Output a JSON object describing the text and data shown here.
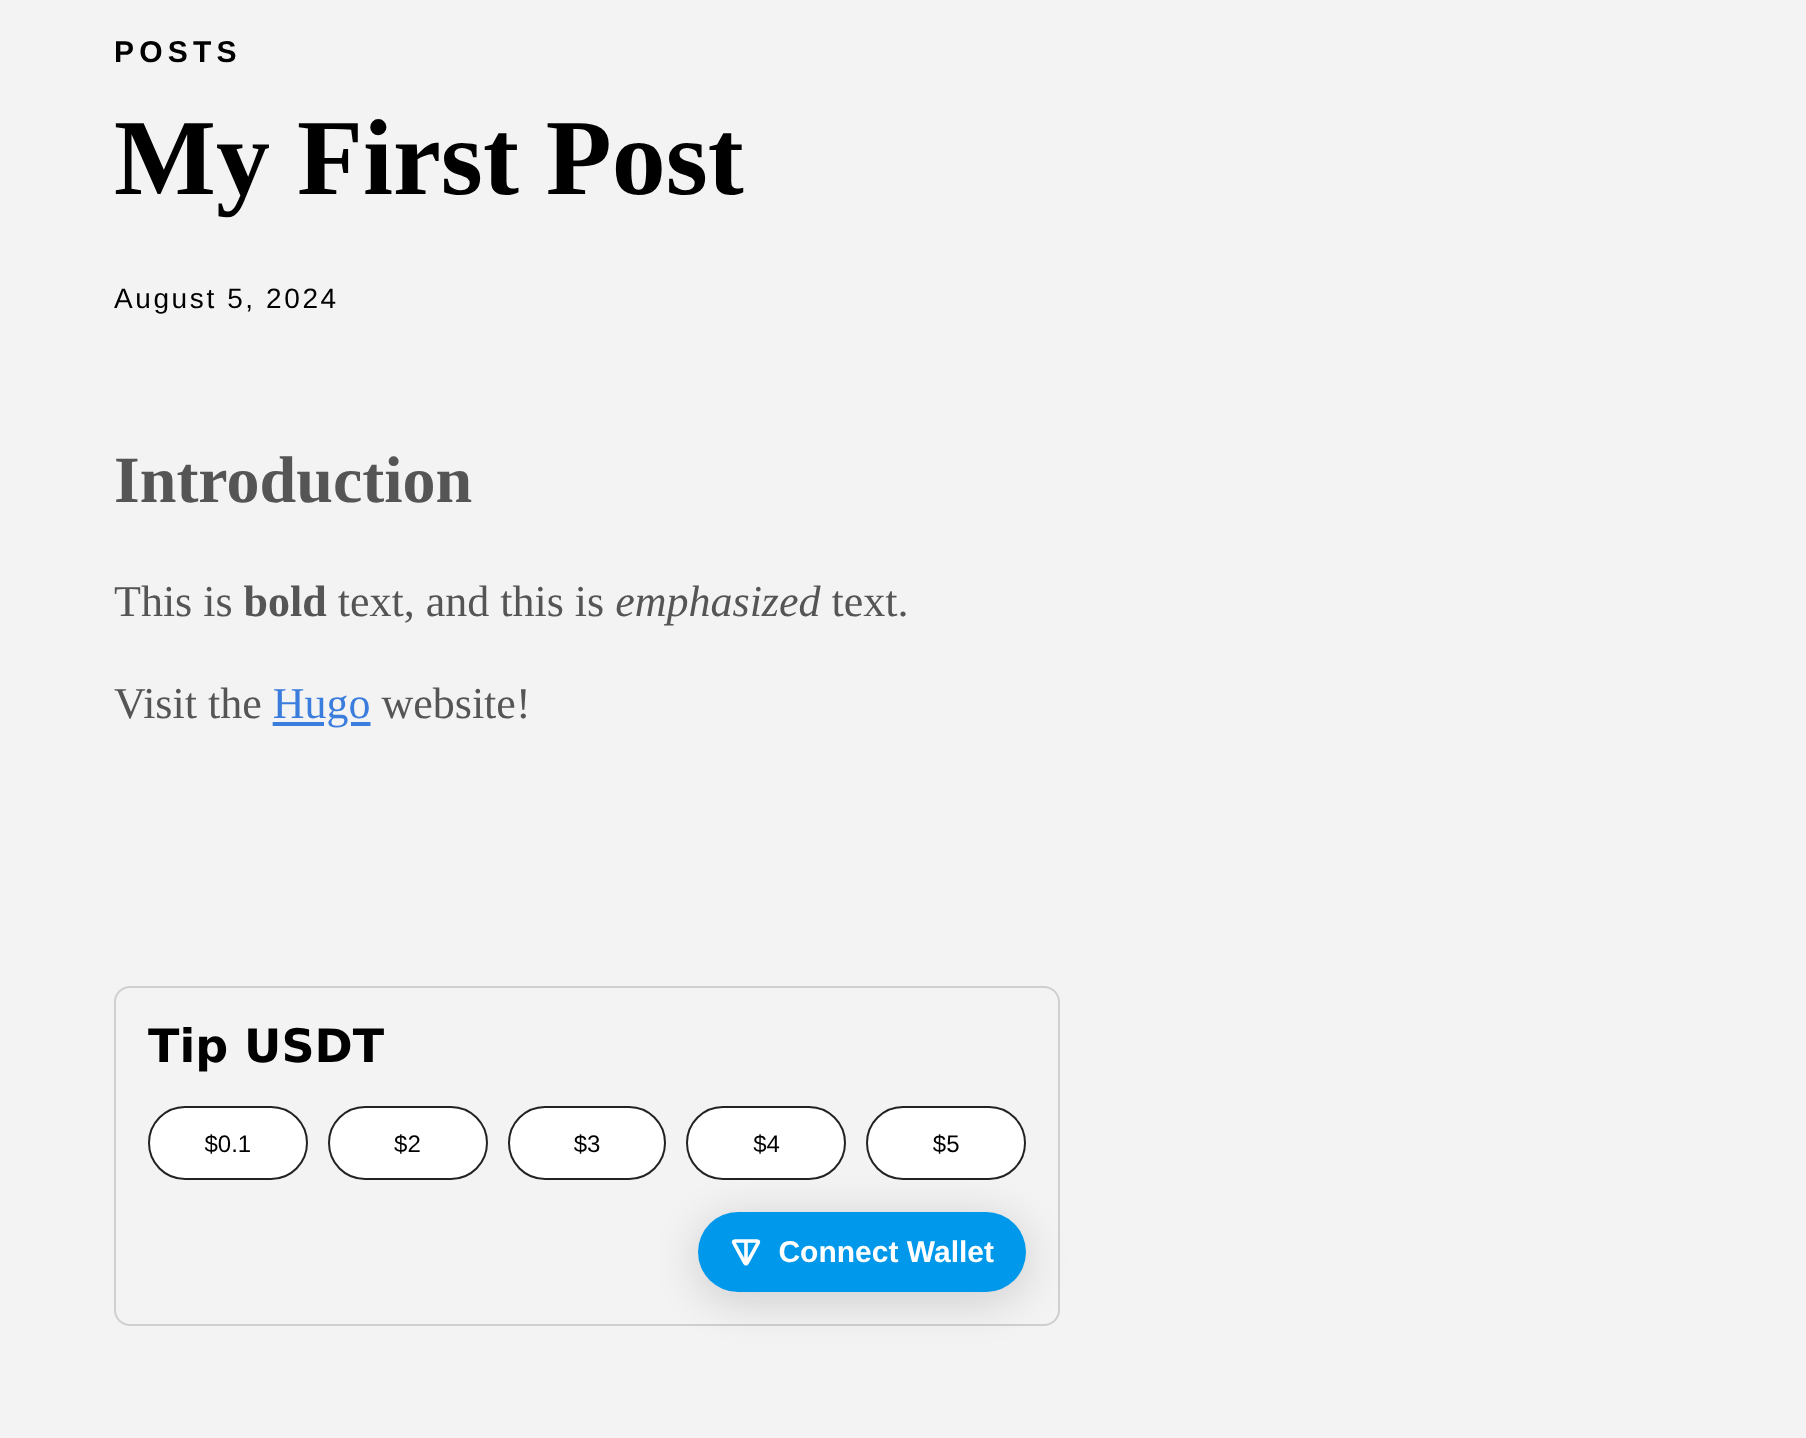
{
  "section_label": "POSTS",
  "post": {
    "title": "My First Post",
    "date": "August 5, 2024"
  },
  "content": [
    {
      "kind": "heading",
      "text": "Introduction"
    },
    {
      "kind": "paragraph",
      "text": "This is **bold** text, and this is *emphasized* text."
    },
    {
      "kind": "link_paragraph",
      "before": "Visit the",
      "link": "Hugo",
      "after": "website!"
    }
  ],
  "tip_widget": {
    "title": "Tip USDT",
    "amounts": [
      "$0.1",
      "$2",
      "$3",
      "$4",
      "$5"
    ],
    "connect_button": "Connect Wallet"
  }
}
